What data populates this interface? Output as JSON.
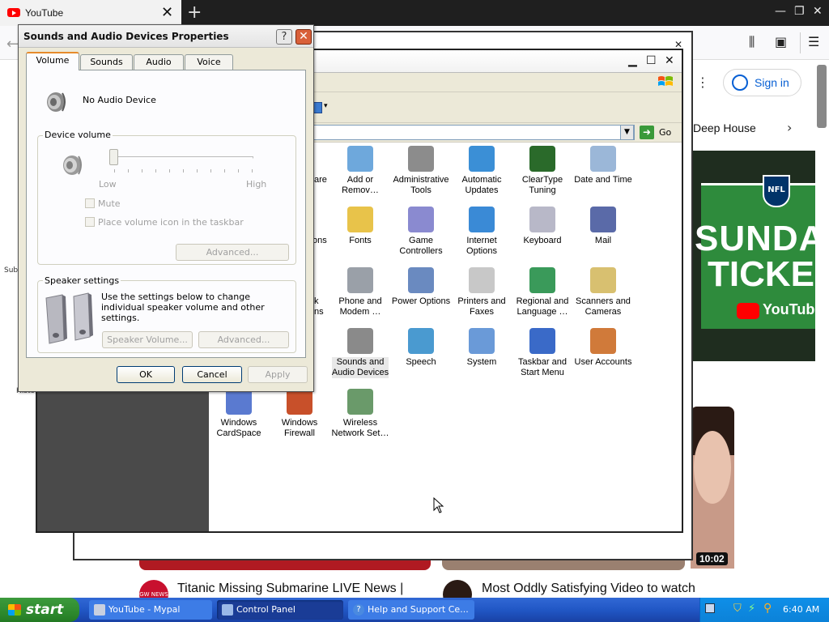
{
  "browser": {
    "tab_title": "YouTube",
    "tab_close": "✕",
    "new_tab": "+",
    "signin": "Sign in",
    "chip": "Deep House",
    "duration": "10:02",
    "video1_title": "Titanic Missing Submarine LIVE News |",
    "video2_title": "Most Oddly Satisfying Video to watch",
    "channel1_badge": "GW NEWS",
    "fragment_sub": "Sub",
    "fragment_hist": "Histo"
  },
  "nfl_ad": {
    "line1": "SUNDA",
    "line2": "TICKE",
    "brand": "YouTube",
    "logo": "NFL"
  },
  "control_panel": {
    "go_label": "Go",
    "cut_labels": [
      "are",
      "ons",
      "k",
      "ns"
    ],
    "items": [
      {
        "label": "Add or\nRemov…",
        "icon": "add-remove-icon",
        "color": "#6ea8dc"
      },
      {
        "label": "Administrative\nTools",
        "icon": "admin-tools-icon",
        "color": "#8c8c8c"
      },
      {
        "label": "Automatic\nUpdates",
        "icon": "automatic-updates-icon",
        "color": "#3b8fd6"
      },
      {
        "label": "ClearType\nTuning",
        "icon": "cleartype-icon",
        "color": "#2a6a2a"
      },
      {
        "label": "Date and Time",
        "icon": "date-time-icon",
        "color": "#9bb7d8"
      },
      {
        "label": "Fonts",
        "icon": "fonts-icon",
        "color": "#e8c34a"
      },
      {
        "label": "Game\nControllers",
        "icon": "game-controllers-icon",
        "color": "#8a8ad0"
      },
      {
        "label": "Internet\nOptions",
        "icon": "internet-options-icon",
        "color": "#3a8ad6"
      },
      {
        "label": "Keyboard",
        "icon": "keyboard-icon",
        "color": "#b8b8c8"
      },
      {
        "label": "Mail",
        "icon": "mail-icon",
        "color": "#5a6aa8"
      },
      {
        "label": "Phone and\nModem …",
        "icon": "phone-modem-icon",
        "color": "#9aa0a8"
      },
      {
        "label": "Power Options",
        "icon": "power-options-icon",
        "color": "#6a8ac0"
      },
      {
        "label": "Printers and\nFaxes",
        "icon": "printers-icon",
        "color": "#c8c8c8"
      },
      {
        "label": "Regional and\nLanguage …",
        "icon": "regional-icon",
        "color": "#3a9a5a"
      },
      {
        "label": "Scanners and\nCameras",
        "icon": "scanners-icon",
        "color": "#d8c070"
      },
      {
        "label": "Sounds and\nAudio Devices",
        "icon": "sounds-icon",
        "color": "#8a8a8a"
      },
      {
        "label": "Speech",
        "icon": "speech-icon",
        "color": "#4a9ad0"
      },
      {
        "label": "System",
        "icon": "system-icon",
        "color": "#6a9ad8"
      },
      {
        "label": "Taskbar and\nStart Menu",
        "icon": "taskbar-icon",
        "color": "#3a6ac8"
      },
      {
        "label": "User Accounts",
        "icon": "user-accounts-icon",
        "color": "#d07a3a"
      },
      {
        "label": "Windows\nCardSpace",
        "icon": "cardspace-icon",
        "color": "#5a7ad0"
      },
      {
        "label": "Windows\nFirewall",
        "icon": "firewall-icon",
        "color": "#c8502a"
      },
      {
        "label": "Wireless\nNetwork Set…",
        "icon": "wireless-icon",
        "color": "#6a9a6a"
      }
    ]
  },
  "dialog": {
    "title": "Sounds and Audio Devices Properties",
    "help": "?",
    "close": "✕",
    "tabs": [
      "Volume",
      "Sounds",
      "Audio",
      "Voice"
    ],
    "device_name": "No Audio Device",
    "device_volume_group": "Device volume",
    "low": "Low",
    "high": "High",
    "mute": "Mute",
    "place_icon": "Place volume icon in the taskbar",
    "advanced1": "Advanced...",
    "speaker_group": "Speaker settings",
    "speaker_desc": "Use the settings below to change individual speaker volume and other settings.",
    "speaker_volume": "Speaker Volume...",
    "advanced2": "Advanced...",
    "ok": "OK",
    "cancel": "Cancel",
    "apply": "Apply"
  },
  "taskbar": {
    "start": "start",
    "buttons": [
      "YouTube - Mypal",
      "Control Panel",
      "Help and Support Ce..."
    ],
    "clock": "6:40 AM"
  }
}
